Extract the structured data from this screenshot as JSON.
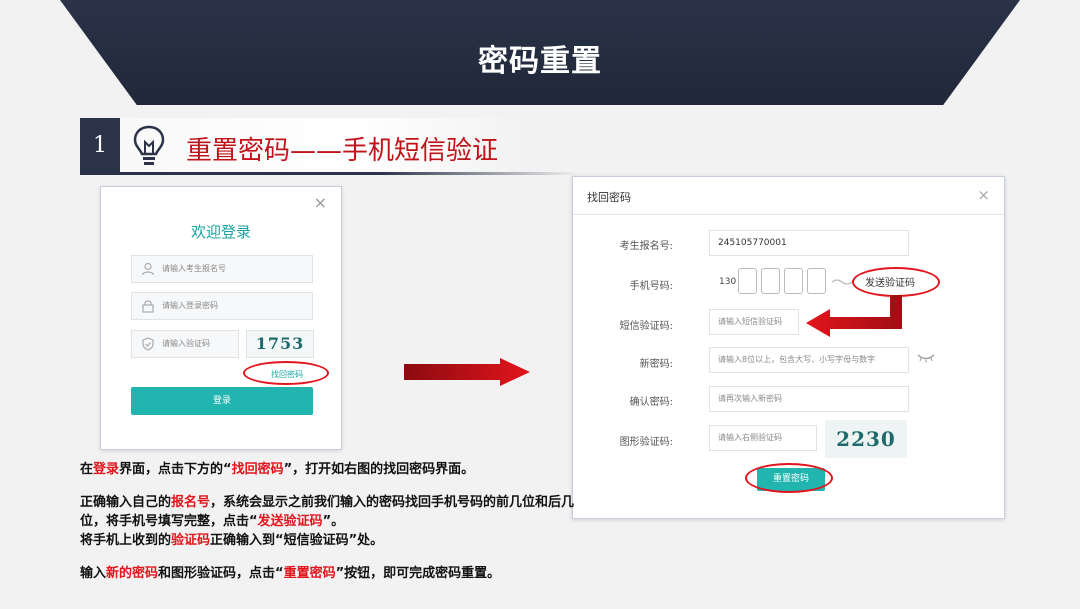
{
  "header": {
    "title": "密码重置"
  },
  "step": {
    "number": "1",
    "title": "重置密码——手机短信验证"
  },
  "login": {
    "title": "欢迎登录",
    "close": "×",
    "exam_id_placeholder": "请输入考生报名号",
    "password_placeholder": "请输入登录密码",
    "captcha_placeholder": "请输入验证码",
    "captcha_text": "1753",
    "forgot_link": "找回密码",
    "login_button": "登录"
  },
  "find": {
    "title": "找回密码",
    "close": "×",
    "labels": {
      "exam_id": "考生报名号:",
      "phone": "手机号码:",
      "sms_code": "短信验证码:",
      "new_password": "新密码:",
      "confirm_password": "确认密码:",
      "image_code": "图形验证码:"
    },
    "exam_id_value": "245105770001",
    "phone_prefix": "130",
    "send_code": "发送验证码",
    "sms_placeholder": "请输入短信验证码",
    "new_password_placeholder": "请输入8位以上，包含大写、小写字母与数字",
    "confirm_placeholder": "请再次输入新密码",
    "image_code_placeholder": "请输入右侧验证码",
    "captcha_text": "2230",
    "reset_button": "重置密码"
  },
  "instructions": {
    "p1": [
      "在",
      "登录",
      "界面，点击下方的“",
      "找回密码",
      "”，打开如右图的找回密码界面。"
    ],
    "p2": [
      "正确输入自己的",
      "报名号",
      "，系统会显示之前我们输入的密码找回手机号码的前几位和后几位，将手机号填写完整，点击“",
      "发送验证码",
      "”。"
    ],
    "p3": [
      "将手机上收到的",
      "验证码",
      "正确输入到“短信验证码”处。"
    ],
    "p4": [
      "输入",
      "新的密码",
      "和图形验证码，点击“",
      "重置密码",
      "”按钮，即可完成密码重置。"
    ]
  },
  "colors": {
    "accent_red": "#e3141c",
    "teal": "#22b5b0",
    "navy": "#2b3349"
  }
}
